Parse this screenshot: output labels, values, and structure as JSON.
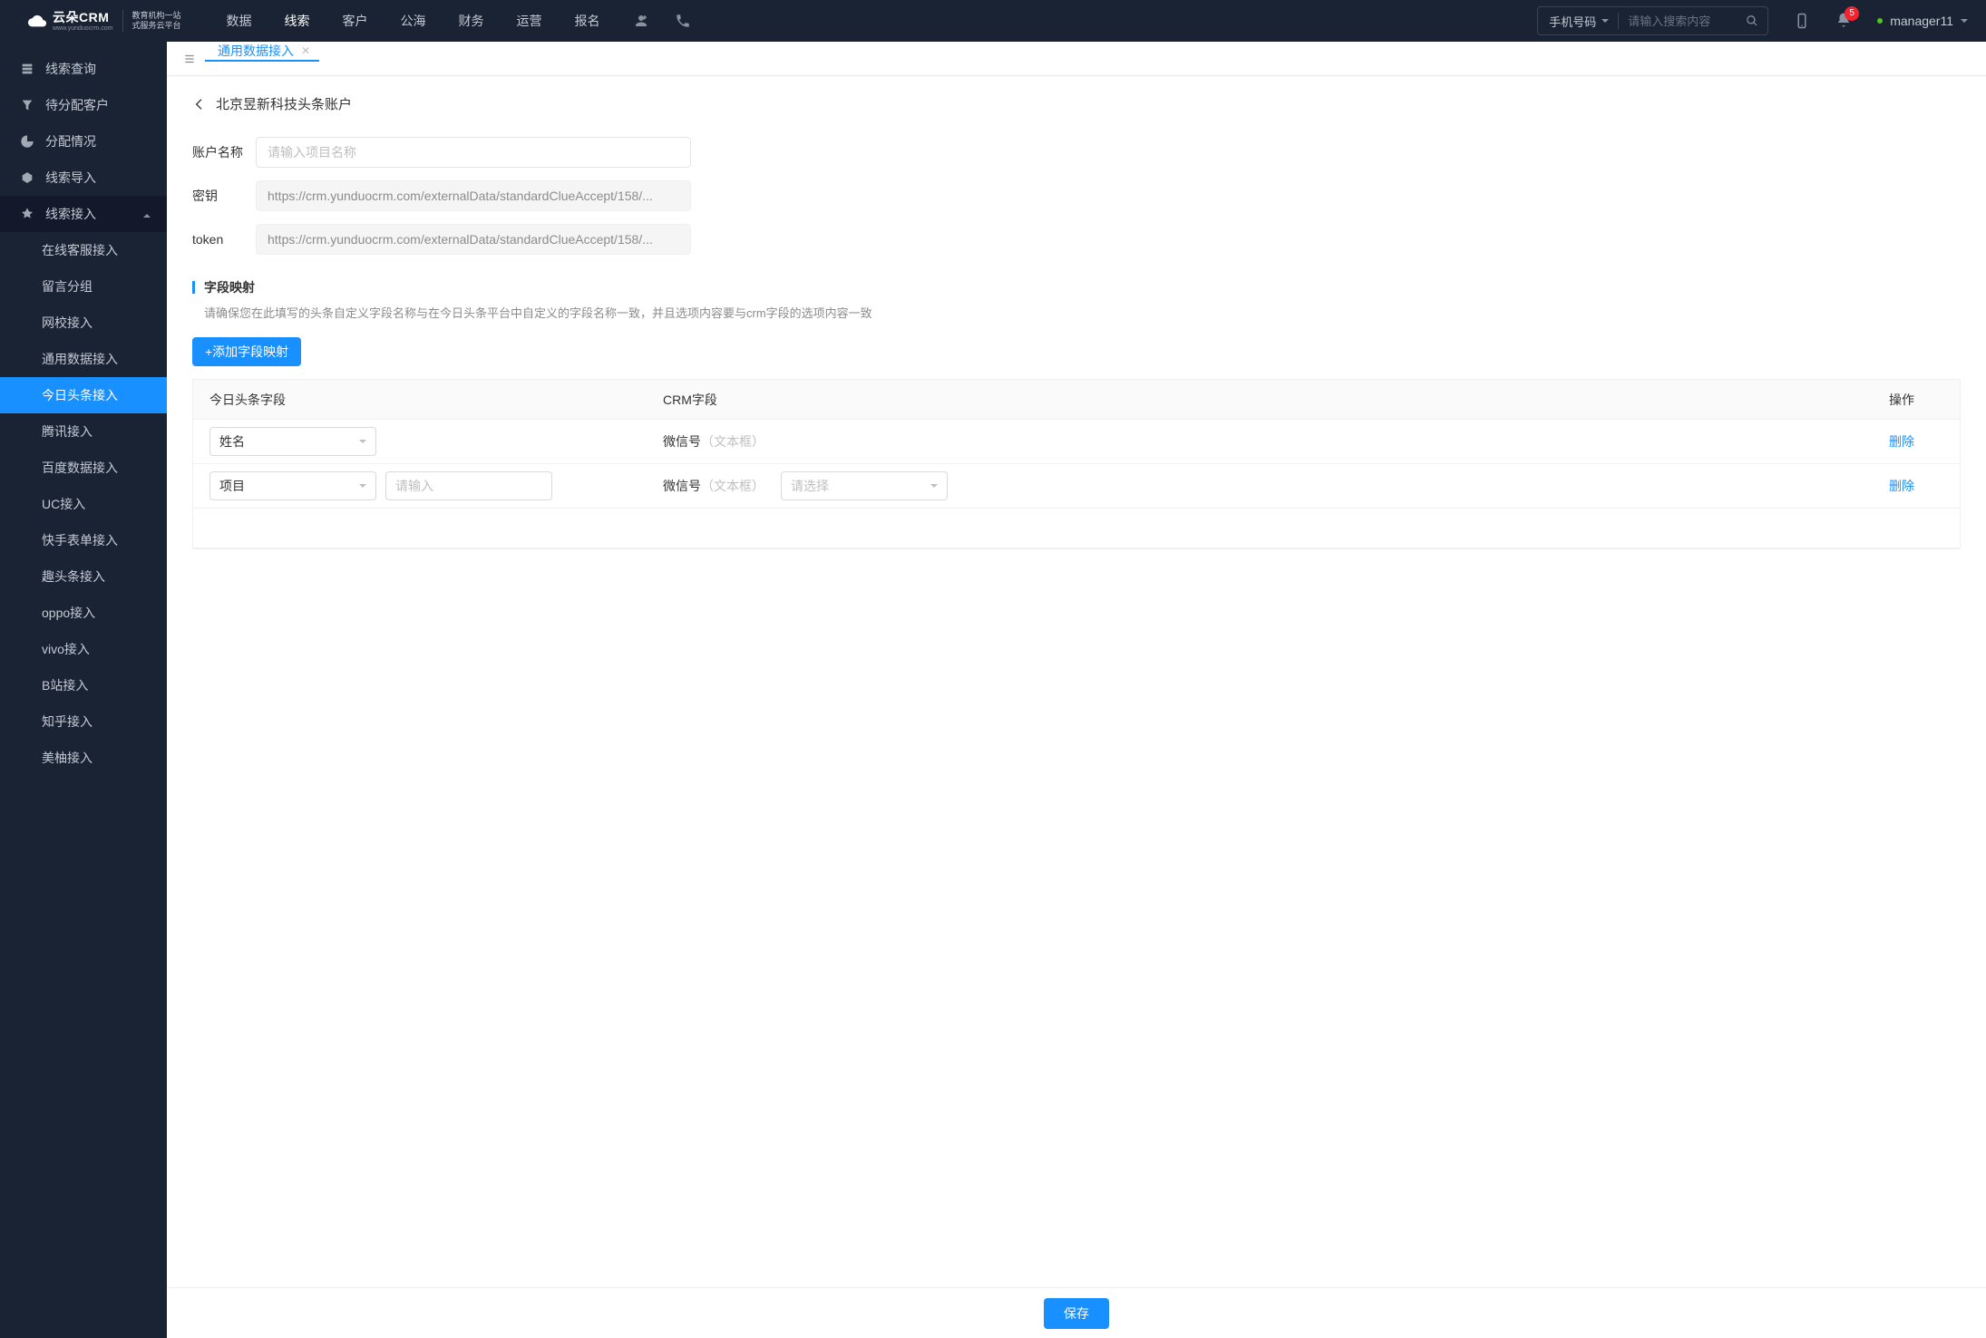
{
  "header": {
    "logo_main": "云朵CRM",
    "logo_sub": "www.yunduocrm.com",
    "logo_desc1": "教育机构一站",
    "logo_desc2": "式服务云平台",
    "nav": [
      "数据",
      "线索",
      "客户",
      "公海",
      "财务",
      "运营",
      "报名"
    ],
    "nav_active_index": 1,
    "search_select": "手机号码",
    "search_placeholder": "请输入搜索内容",
    "badge_count": "5",
    "username": "manager11"
  },
  "sidebar": {
    "top": [
      {
        "label": "线索查询"
      },
      {
        "label": "待分配客户"
      },
      {
        "label": "分配情况"
      },
      {
        "label": "线索导入"
      }
    ],
    "expanded_label": "线索接入",
    "sub": [
      "在线客服接入",
      "留言分组",
      "网校接入",
      "通用数据接入",
      "今日头条接入",
      "腾讯接入",
      "百度数据接入",
      "UC接入",
      "快手表单接入",
      "趣头条接入",
      "oppo接入",
      "vivo接入",
      "B站接入",
      "知乎接入",
      "美柚接入"
    ],
    "sub_active_index": 4
  },
  "tabs": {
    "items": [
      {
        "label": "通用数据接入"
      }
    ],
    "active_index": 0
  },
  "page": {
    "breadcrumb_title": "北京昱新科技头条账户",
    "form": {
      "account_label": "账户名称",
      "account_placeholder": "请输入项目名称",
      "secret_label": "密钥",
      "secret_value": "https://crm.yunduocrm.com/externalData/standardClueAccept/158/...",
      "token_label": "token",
      "token_value": "https://crm.yunduocrm.com/externalData/standardClueAccept/158/..."
    },
    "mapping": {
      "title": "字段映射",
      "hint": "请确保您在此填写的头条自定义字段名称与在今日头条平台中自定义的字段名称一致，并且选项内容要与crm字段的选项内容一致",
      "add_button": "+添加字段映射",
      "columns": {
        "c1": "今日头条字段",
        "c2": "CRM字段",
        "c3": "操作"
      },
      "rows": [
        {
          "field_select": "姓名",
          "has_extra_input": false,
          "crm_field": "微信号",
          "crm_type": "（文本框）",
          "has_crm_select": false,
          "action": "删除"
        },
        {
          "field_select": "项目",
          "has_extra_input": true,
          "extra_input_placeholder": "请输入",
          "crm_field": "微信号",
          "crm_type": "（文本框）",
          "has_crm_select": true,
          "crm_select_placeholder": "请选择",
          "action": "删除"
        }
      ]
    },
    "save_button": "保存"
  }
}
